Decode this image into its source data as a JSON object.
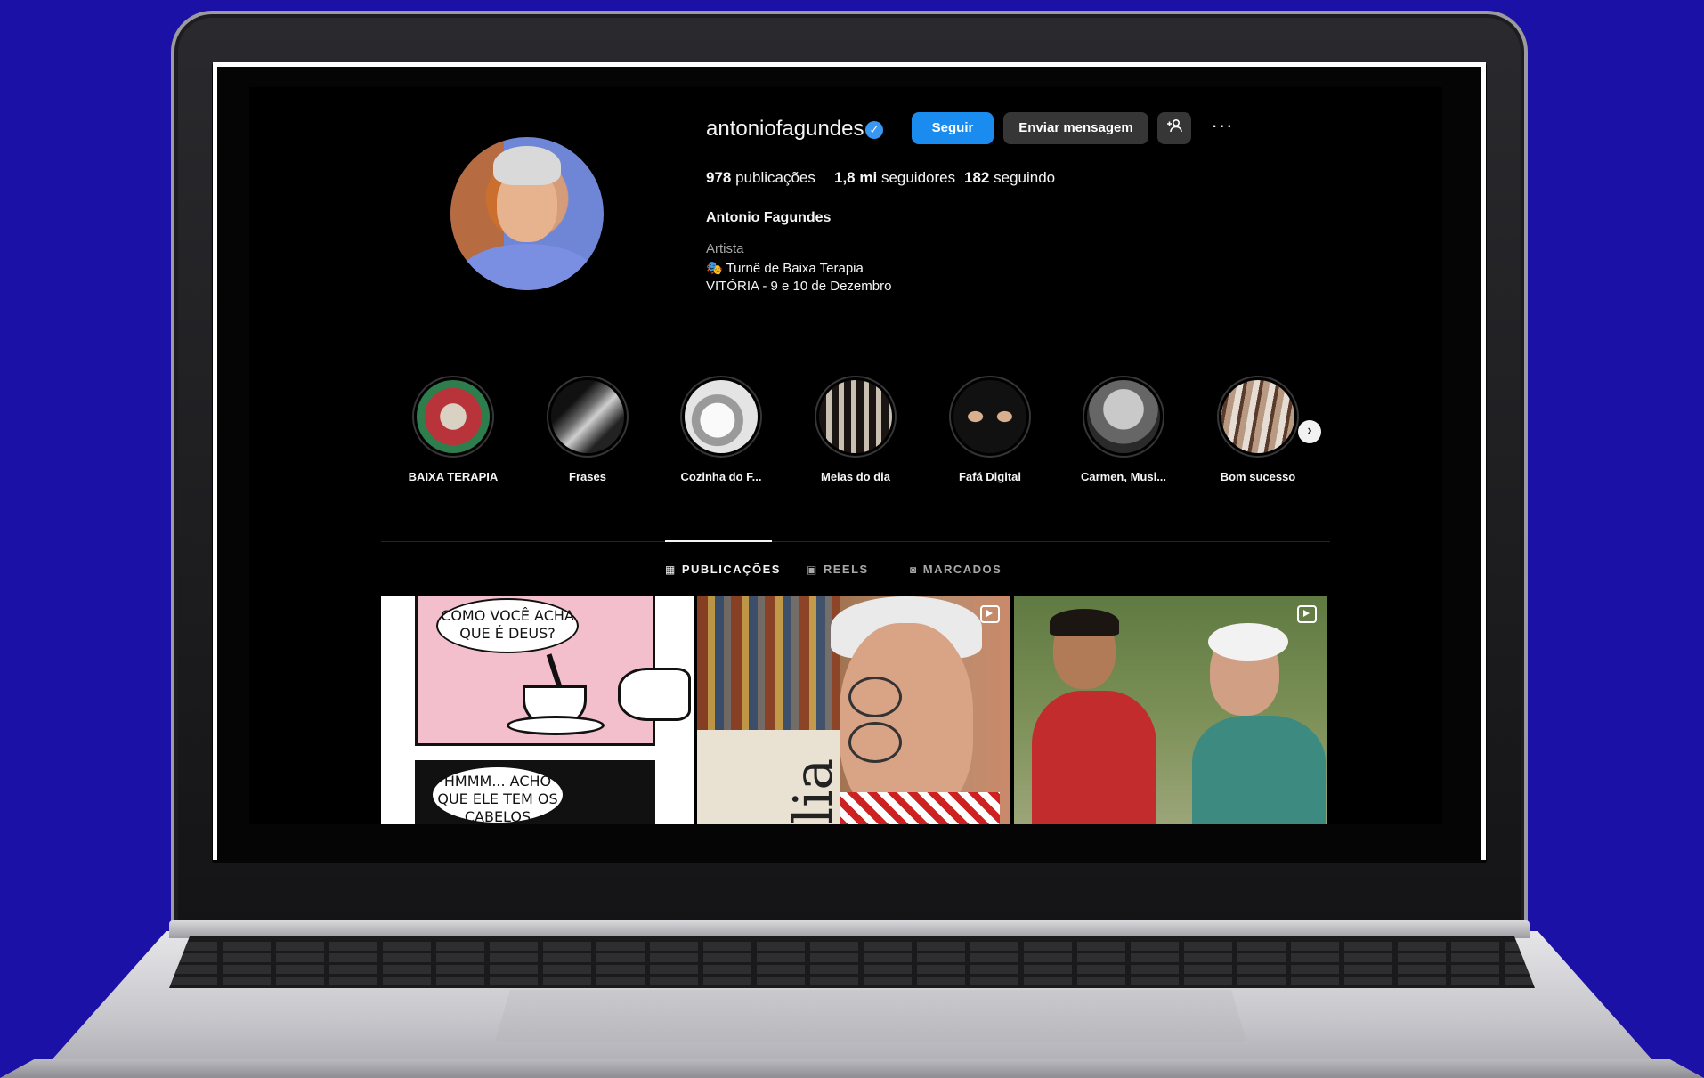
{
  "profile": {
    "username": "antoniofagundes",
    "verified_mark": "✓",
    "buttons": {
      "follow": "Seguir",
      "message": "Enviar mensagem",
      "suggest": "+&",
      "more": "···"
    },
    "stats": [
      {
        "count": "978",
        "label": "publicações"
      },
      {
        "count": "1,8 mi",
        "label": "seguidores"
      },
      {
        "count": "182",
        "label": "seguindo"
      }
    ],
    "full_name": "Antonio Fagundes",
    "category": "Artista",
    "bio_line_1": "🎭 Turnê de Baixa Terapia",
    "bio_line_2": "VITÓRIA - 9 e 10 de Dezembro"
  },
  "highlights": [
    {
      "label": "BAIXA TERAPIA",
      "color": "#b8333a"
    },
    {
      "label": "Frases",
      "color": "#3a3a3a"
    },
    {
      "label": "Cozinha do F...",
      "color": "#cfcfcf"
    },
    {
      "label": "Meias do dia",
      "color": "#2a2420"
    },
    {
      "label": "Fafá Digital",
      "color": "#1a1a1a"
    },
    {
      "label": "Carmen, Musi...",
      "color": "#8f8f8f"
    },
    {
      "label": "Bom sucesso",
      "color": "#9a7e6a"
    }
  ],
  "highlights_next": "›",
  "tabs": [
    {
      "label": "PUBLICAÇÕES",
      "icon": "grid-icon",
      "glyph": "▦",
      "active": true
    },
    {
      "label": "REELS",
      "icon": "reels-icon",
      "glyph": "▣",
      "active": false
    },
    {
      "label": "MARCADOS",
      "icon": "tagged-icon",
      "glyph": "◙",
      "active": false
    }
  ],
  "posts": {
    "comic_bubble_1": "COMO VOCÊ ACHA QUE É DEUS?",
    "comic_bubble_2": "HMMM... ACHO QUE ELE TEM OS CABELOS BRANCOS.",
    "book_text": "lia"
  },
  "colors": {
    "background": "#1c11a6",
    "accent": "#1a8cf0",
    "screen": "#000000"
  }
}
